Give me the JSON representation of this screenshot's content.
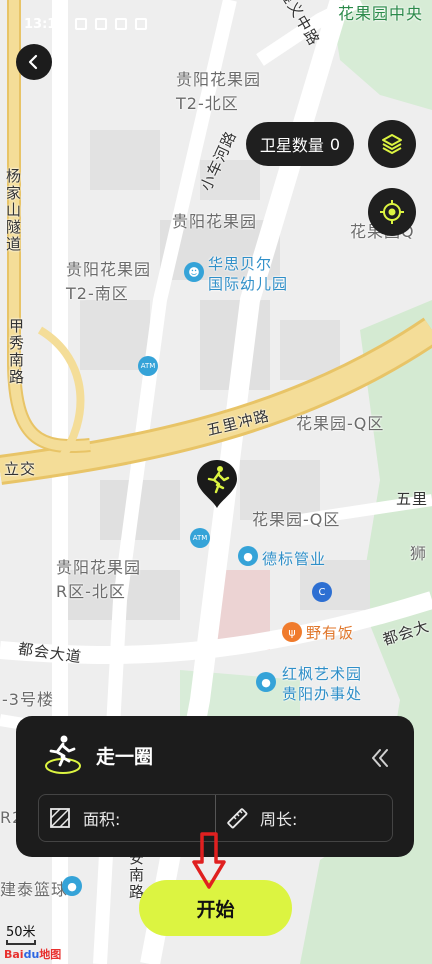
{
  "status": {
    "time": "13:16"
  },
  "header": {
    "satellite_label": "卫星数量",
    "satellite_count": "0"
  },
  "map": {
    "labels": {
      "road_top": "遵义中路",
      "huaguoyuan_top": "花果园中央",
      "t2_north": "贵阳花果园\nT2-北区",
      "xiaochehe": "小车河路",
      "guiyang_hgy": "贵阳花果园",
      "yangjiashan": "杨家山隧道",
      "t2_south": "贵阳花果园\nT2-南区",
      "huasi": "华思贝尔\n国际幼儿园",
      "jiaxiu": "甲秀南路",
      "wuli": "五里冲路",
      "q_area": "花果园-Q区",
      "lijiao": "立交",
      "wuli_right": "五里",
      "r_north": "贵阳花果园\nR区-北区",
      "debiao": "德标管业",
      "yeyou": "野有饭",
      "douhui": "都会大道",
      "douhui_right": "都会大",
      "hongfeng": "红枫艺术园\n贵阳办事处",
      "building3": "-3号楼",
      "jiantai": "建泰篮球",
      "shi": "狮",
      "huaguoyuan_q_top": "花果园Q",
      "anan": "安南路",
      "r2": "R2"
    },
    "scale": "50米",
    "logo_a": "Bai",
    "logo_b": "du",
    "logo_c": "地图"
  },
  "panel": {
    "title": "走一圈",
    "area_label": "面积:",
    "perimeter_label": "周长:"
  },
  "start_button": "开始",
  "icons": {
    "back": "chevron-left-icon",
    "layers": "layers-icon",
    "locate": "locate-icon",
    "runner": "runner-icon",
    "collapse": "double-chevron-left-icon",
    "area": "area-icon",
    "ruler": "ruler-icon",
    "arrow": "down-arrow-icon"
  },
  "colors": {
    "accent": "#dcf441",
    "panel_bg": "#1c1c1c",
    "arrow_red": "#e02020"
  }
}
